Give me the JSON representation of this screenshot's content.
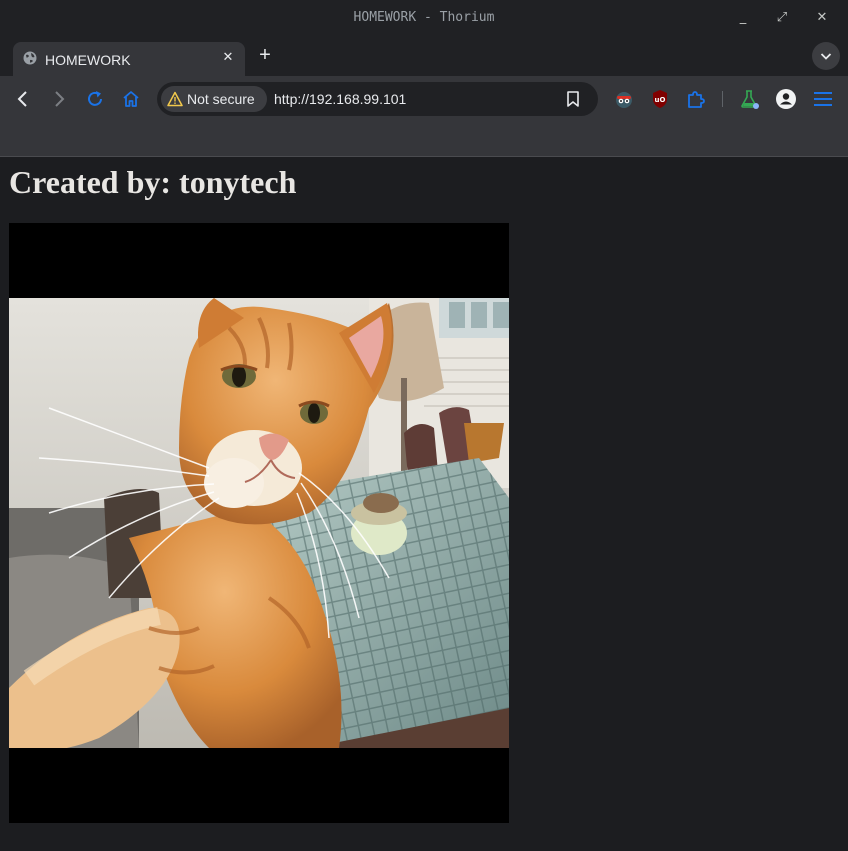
{
  "window": {
    "title": "HOMEWORK - Thorium",
    "minimize_glyph": "_",
    "maximize_glyph": "⤢",
    "close_glyph": "✕"
  },
  "tabs": [
    {
      "title": "HOMEWORK",
      "favicon": "globe-icon",
      "close_glyph": "✕"
    }
  ],
  "new_tab_glyph": "+",
  "toolbar": {
    "security_label": "Not secure",
    "url": "http://192.168.99.101",
    "icons": [
      "back-icon",
      "forward-icon",
      "reload-icon",
      "home-icon",
      "bookmark-star-icon",
      "extension-spy-icon",
      "ublock-icon",
      "extensions-puzzle-icon",
      "labs-flask-icon",
      "profile-icon",
      "menu-icon"
    ]
  },
  "page": {
    "heading": "Created by: tonytech",
    "media": "cat-selfie-video"
  },
  "colors": {
    "accent": "#1a73e8",
    "link_blue": "#8ab4f8",
    "warning": "#f2c94c",
    "page_bg": "#1c1d20"
  }
}
